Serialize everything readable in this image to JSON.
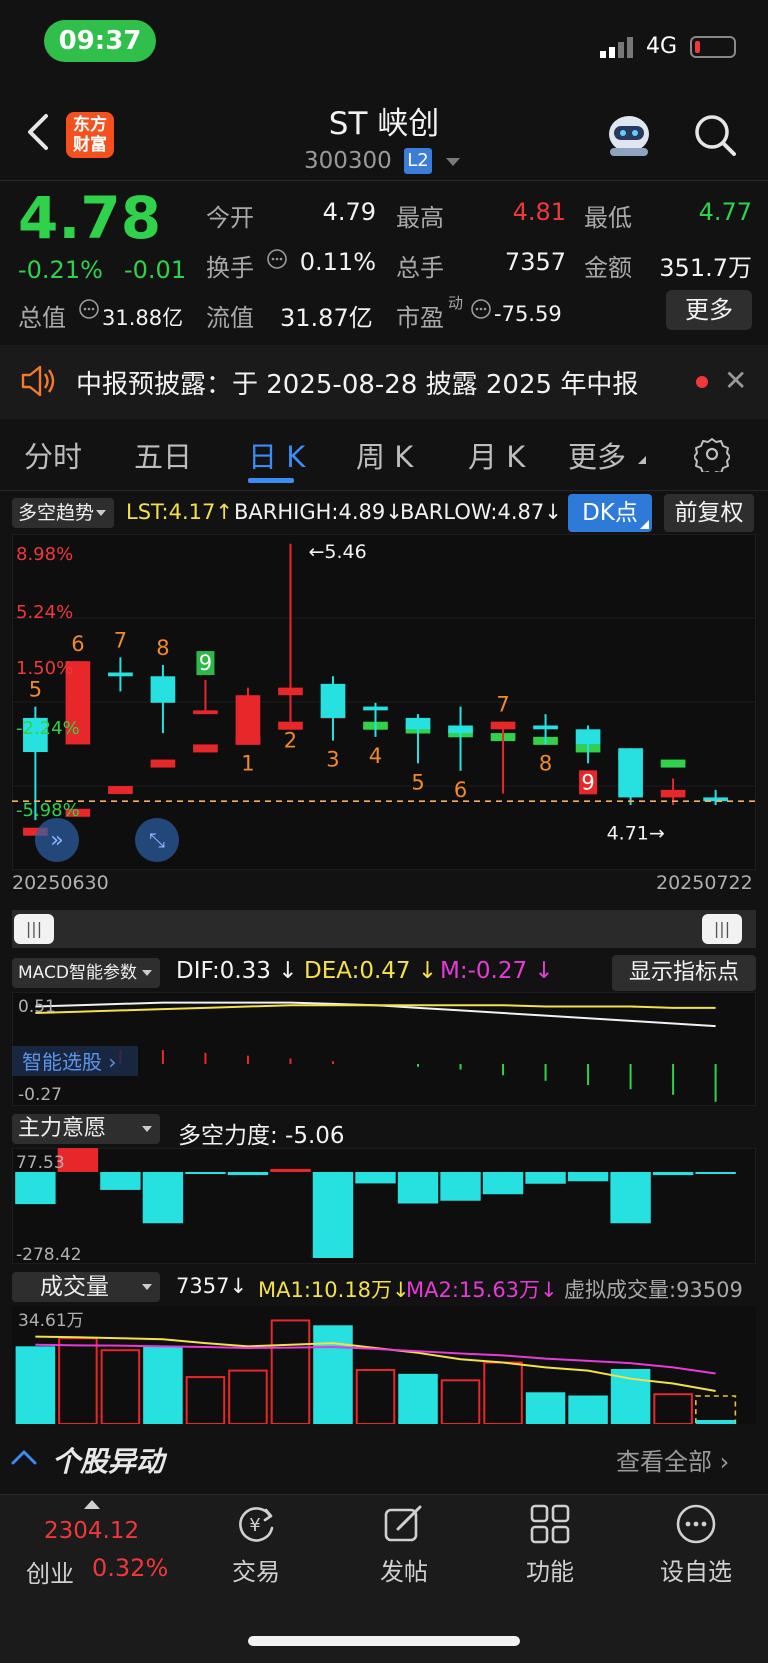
{
  "status": {
    "time": "09:37",
    "network": "4G"
  },
  "header": {
    "logo": "东方财富",
    "title": "ST 峡创",
    "code": "300300",
    "level": "L2"
  },
  "quote": {
    "price": "4.78",
    "pct": "-0.21%",
    "change": "-0.01",
    "fields": [
      {
        "label": "今开",
        "value": "4.79",
        "color": "#f2f2f2"
      },
      {
        "label": "最高",
        "value": "4.81",
        "color": "#f0383c"
      },
      {
        "label": "最低",
        "value": "4.77",
        "color": "#2fd24a"
      },
      {
        "label": "换手",
        "value": "0.11%",
        "color": "#f2f2f2"
      },
      {
        "label": "总手",
        "value": "7357",
        "color": "#f2f2f2"
      },
      {
        "label": "金额",
        "value": "351.7万",
        "color": "#f2f2f2"
      },
      {
        "label": "总值",
        "value": "31.88亿",
        "color": "#f2f2f2"
      },
      {
        "label": "流值",
        "value": "31.87亿",
        "color": "#f2f2f2"
      },
      {
        "label": "市盈",
        "sup": "动",
        "value": "-75.59",
        "color": "#f2f2f2"
      }
    ],
    "more_label": "更多"
  },
  "notice": {
    "text": "中报预披露：于 2025-08-28 披露 2025 年中报"
  },
  "tabs": [
    "分时",
    "五日",
    "日 K",
    "周 K",
    "月 K",
    "更多"
  ],
  "active_tab": "日 K",
  "kline_header": {
    "indicator": "多空趋势",
    "lst": "LST:4.17",
    "barhigh": "BARHIGH:4.89",
    "barlow": "BARLOW:4.87",
    "dk_label": "DK点",
    "fq_label": "前复权"
  },
  "kline": {
    "pct_labels": [
      "8.98%",
      "5.24%",
      "1.50%",
      "-2.24%",
      "-5.98%"
    ],
    "max_label": "←5.46",
    "min_label": "4.71→",
    "start_date": "20250630",
    "end_date": "20250722",
    "candles": [
      {
        "o": 4.91,
        "c": 5.0,
        "h": 5.03,
        "l": 4.73,
        "color": "cyan"
      },
      {
        "o": 4.93,
        "c": 5.15,
        "h": 5.15,
        "l": 4.93,
        "color": "red"
      },
      {
        "o": 5.11,
        "c": 5.12,
        "h": 5.16,
        "l": 5.07,
        "color": "cyan"
      },
      {
        "o": 5.11,
        "c": 5.04,
        "h": 5.14,
        "l": 4.96,
        "color": "cyan"
      },
      {
        "o": 5.01,
        "c": 5.02,
        "h": 5.1,
        "l": 5.01,
        "color": "red"
      },
      {
        "o": 4.93,
        "c": 5.06,
        "h": 5.08,
        "l": 4.93,
        "color": "red"
      },
      {
        "o": 5.06,
        "c": 5.08,
        "h": 5.46,
        "l": 4.99,
        "color": "red"
      },
      {
        "o": 5.09,
        "c": 5.0,
        "h": 5.11,
        "l": 4.94,
        "color": "cyan"
      },
      {
        "o": 5.03,
        "c": 5.02,
        "h": 5.04,
        "l": 4.95,
        "color": "cyan"
      },
      {
        "o": 5.0,
        "c": 4.97,
        "h": 5.01,
        "l": 4.88,
        "color": "cyan"
      },
      {
        "o": 4.98,
        "c": 4.96,
        "h": 5.03,
        "l": 4.86,
        "color": "cyan"
      },
      {
        "o": 4.97,
        "c": 4.99,
        "h": 4.99,
        "l": 4.8,
        "color": "red"
      },
      {
        "o": 4.98,
        "c": 4.97,
        "h": 5.01,
        "l": 4.93,
        "color": "cyan"
      },
      {
        "o": 4.97,
        "c": 4.93,
        "h": 4.98,
        "l": 4.88,
        "color": "cyan"
      },
      {
        "o": 4.92,
        "c": 4.79,
        "h": 4.92,
        "l": 4.77,
        "color": "cyan"
      },
      {
        "o": 4.79,
        "c": 4.81,
        "h": 4.84,
        "l": 4.77,
        "color": "red"
      },
      {
        "o": 4.79,
        "c": 4.78,
        "h": 4.81,
        "l": 4.77,
        "color": "cyan"
      }
    ],
    "dk_bars": [
      {
        "top": 4.82,
        "color": "red"
      },
      {
        "top": 4.89,
        "color": "red"
      },
      {
        "top": 4.93,
        "color": "red"
      },
      {
        "top": 4.95,
        "color": "red"
      },
      {
        "top": 4.99,
        "color": "red"
      },
      {
        "top": 5.02,
        "color": "red"
      },
      {
        "top": 4.99,
        "color": "green"
      },
      {
        "top": 4.98,
        "color": "green"
      },
      {
        "top": 4.97,
        "color": "green"
      },
      {
        "top": 4.96,
        "color": "green"
      },
      {
        "top": 4.95,
        "color": "green"
      },
      {
        "top": 4.93,
        "color": "green"
      },
      {
        "top": 4.91,
        "color": "green"
      },
      {
        "top": 4.89,
        "color": "green"
      }
    ],
    "counts": [
      {
        "i": 0,
        "t": "5",
        "pos": "above",
        "fill": "orange"
      },
      {
        "i": 1,
        "t": "6",
        "pos": "above",
        "fill": "orange"
      },
      {
        "i": 2,
        "t": "7",
        "pos": "above",
        "fill": "orange"
      },
      {
        "i": 3,
        "t": "8",
        "pos": "above",
        "fill": "orange"
      },
      {
        "i": 4,
        "t": "9",
        "pos": "above",
        "fill": "greenbox"
      },
      {
        "i": 5,
        "t": "1",
        "pos": "below",
        "fill": "orange"
      },
      {
        "i": 6,
        "t": "2",
        "pos": "below",
        "fill": "orange"
      },
      {
        "i": 7,
        "t": "3",
        "pos": "below",
        "fill": "orange"
      },
      {
        "i": 8,
        "t": "4",
        "pos": "below",
        "fill": "orange"
      },
      {
        "i": 9,
        "t": "5",
        "pos": "below",
        "fill": "orange"
      },
      {
        "i": 10,
        "t": "6",
        "pos": "below",
        "fill": "orange"
      },
      {
        "i": 11,
        "t": "7",
        "pos": "above",
        "fill": "orange"
      },
      {
        "i": 12,
        "t": "8",
        "pos": "below",
        "fill": "orange"
      },
      {
        "i": 13,
        "t": "9",
        "pos": "below",
        "fill": "redbox"
      }
    ],
    "ref_price": 4.78
  },
  "macd": {
    "selector": "MACD智能参数",
    "dif": "DIF:0.33",
    "dea": "DEA:0.47",
    "m": "M:-0.27",
    "show_points": "显示指标点",
    "top_label": "0.51",
    "bottom_label": "-0.27",
    "overlay": "智能选股",
    "dif_series": [
      0.48,
      0.49,
      0.5,
      0.51,
      0.51,
      0.51,
      0.51,
      0.5,
      0.49,
      0.47,
      0.45,
      0.43,
      0.41,
      0.39,
      0.37,
      0.35,
      0.33
    ],
    "dea_series": [
      0.43,
      0.44,
      0.45,
      0.46,
      0.47,
      0.48,
      0.49,
      0.49,
      0.49,
      0.49,
      0.49,
      0.49,
      0.48,
      0.48,
      0.48,
      0.47,
      0.47
    ],
    "hist": [
      0.1,
      0.1,
      0.1,
      0.1,
      0.08,
      0.06,
      0.04,
      0.02,
      0.0,
      -0.02,
      -0.04,
      -0.08,
      -0.12,
      -0.15,
      -0.18,
      -0.22,
      -0.27
    ]
  },
  "zhuli": {
    "selector": "主力意愿",
    "label": "多空力度: -5.06",
    "top_label": "77.53",
    "bottom_label": "-278.42",
    "values": [
      -104,
      77.53,
      -58,
      -166,
      -3,
      -10,
      10,
      -278.42,
      -37,
      -102,
      -93,
      -72,
      -38,
      -30,
      -166,
      -10,
      -6
    ]
  },
  "volume": {
    "selector": "成交量",
    "vol": "7357",
    "ma1": "MA1:10.18万",
    "ma2": "MA2:15.63万",
    "virtual": "虚拟成交量:93509",
    "top_label": "34.61万",
    "bars": [
      {
        "v": 24.0,
        "color": "cyan"
      },
      {
        "v": 26.5,
        "color": "red"
      },
      {
        "v": 22.8,
        "color": "red"
      },
      {
        "v": 24.0,
        "color": "cyan"
      },
      {
        "v": 14.5,
        "color": "red"
      },
      {
        "v": 16.5,
        "color": "red"
      },
      {
        "v": 32.0,
        "color": "red"
      },
      {
        "v": 30.5,
        "color": "cyan"
      },
      {
        "v": 16.7,
        "color": "red"
      },
      {
        "v": 15.5,
        "color": "cyan"
      },
      {
        "v": 13.5,
        "color": "red"
      },
      {
        "v": 19.0,
        "color": "red"
      },
      {
        "v": 9.8,
        "color": "cyan"
      },
      {
        "v": 8.8,
        "color": "cyan"
      },
      {
        "v": 17.0,
        "color": "cyan"
      },
      {
        "v": 9.2,
        "color": "red"
      },
      {
        "v": 0.74,
        "color": "cyan"
      }
    ],
    "ma1_series": [
      27,
      26.8,
      26.5,
      26.2,
      25,
      24,
      24.5,
      25,
      23.5,
      22,
      20,
      19,
      17.5,
      16.5,
      14,
      12.5,
      10.2
    ],
    "ma2_series": [
      24.5,
      24.3,
      24.2,
      24.0,
      23.8,
      23.5,
      23.6,
      23.8,
      23.2,
      22.5,
      21.8,
      21.2,
      20.2,
      19.5,
      18.8,
      17.5,
      15.6
    ]
  },
  "yidong": {
    "title": "个股异动",
    "view_all": "查看全部"
  },
  "index": {
    "value": "2304.12",
    "name": "创业",
    "pct": "0.32%"
  },
  "tabbar": [
    {
      "label": "交易",
      "icon": "trade-icon"
    },
    {
      "label": "发帖",
      "icon": "post-icon"
    },
    {
      "label": "功能",
      "icon": "grid-icon"
    },
    {
      "label": "设自选",
      "icon": "add-watch-icon"
    }
  ]
}
